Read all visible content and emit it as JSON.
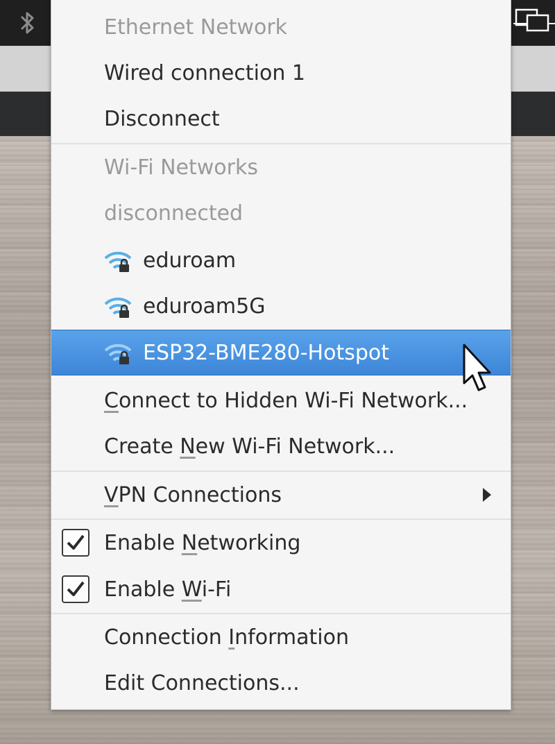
{
  "menu": {
    "ethernet_header": "Ethernet Network",
    "wired_connection": "Wired connection 1",
    "disconnect": "Disconnect",
    "wifi_header": "Wi-Fi Networks",
    "wifi_status": "disconnected",
    "networks": [
      {
        "ssid": "eduroam",
        "icon": "wifi-lock-icon"
      },
      {
        "ssid": "eduroam5G",
        "icon": "wifi-lock-icon"
      },
      {
        "ssid": "ESP32-BME280-Hotspot",
        "icon": "wifi-lock-icon",
        "selected": true
      }
    ],
    "connect_hidden": {
      "pre": "",
      "mnemonic": "C",
      "post": "onnect to Hidden Wi-Fi Network..."
    },
    "create_new": {
      "pre": "Create ",
      "mnemonic": "N",
      "post": "ew Wi-Fi Network..."
    },
    "vpn": {
      "pre": "",
      "mnemonic": "V",
      "post": "PN Connections"
    },
    "enable_networking": {
      "pre": "Enable ",
      "mnemonic": "N",
      "post": "etworking",
      "checked": true
    },
    "enable_wifi": {
      "pre": "Enable ",
      "mnemonic": "W",
      "post": "i-Fi",
      "checked": true
    },
    "connection_info": {
      "pre": "Connection ",
      "mnemonic": "I",
      "post": "nformation"
    },
    "edit_connections": "Edit Connections..."
  },
  "colors": {
    "selection": "#3d86d8",
    "wifi_icon": "#5aaee8",
    "header_text": "#9a9a9a"
  }
}
